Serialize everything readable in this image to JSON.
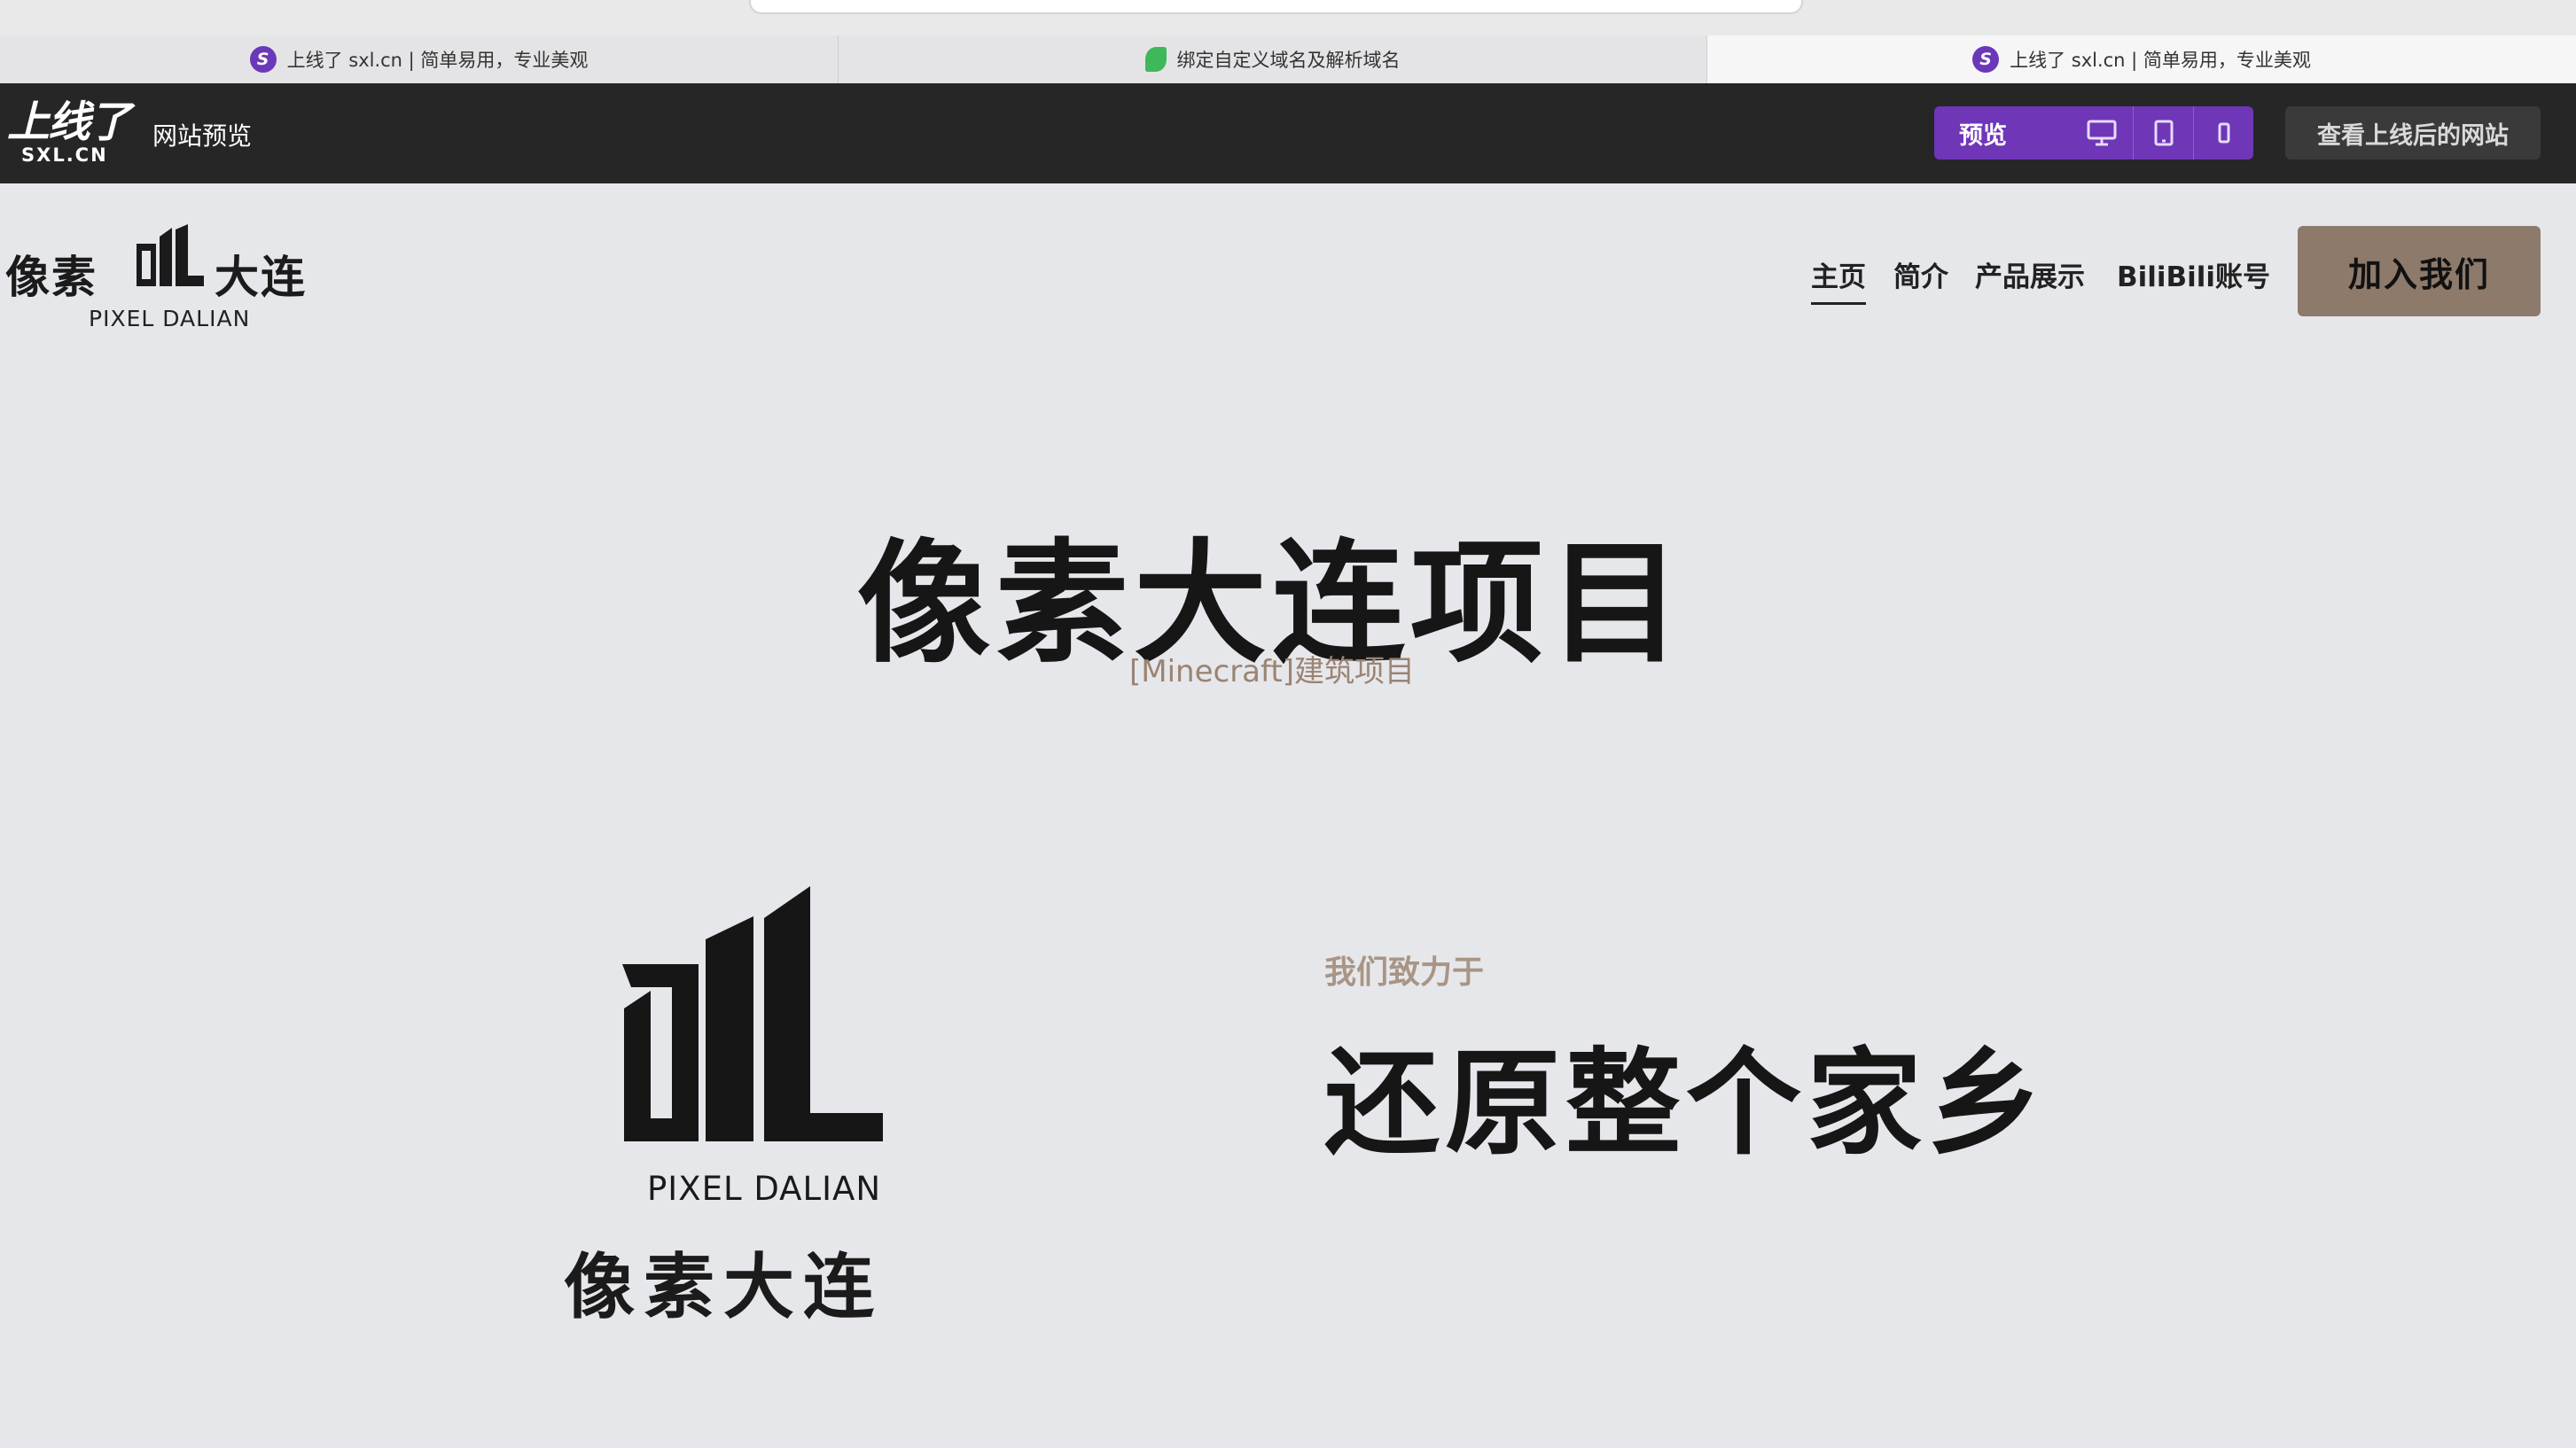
{
  "browser": {
    "tabs": [
      {
        "title": "上线了 sxl.cn | 简单易用，专业美观",
        "icon": "sxl-favicon",
        "active": false
      },
      {
        "title": "绑定自定义域名及解析域名",
        "icon": "leaf-favicon",
        "active": false
      },
      {
        "title": "上线了 sxl.cn | 简单易用，专业美观",
        "icon": "sxl-favicon",
        "active": true
      }
    ]
  },
  "toolbar": {
    "logo_main": "上线了",
    "logo_sub": "SXL.CN",
    "title": "网站预览",
    "preview_label": "预览",
    "devices": [
      "desktop-icon",
      "tablet-icon",
      "mobile-icon"
    ],
    "view_site_label": "查看上线后的网站",
    "accent": "#6f36b8"
  },
  "site": {
    "logo_cn_left": "像素",
    "logo_cn_right": "大连",
    "logo_en": "PIXEL DALIAN",
    "nav": [
      {
        "label": "主页",
        "active": true
      },
      {
        "label": "简介",
        "active": false
      },
      {
        "label": "产品展示",
        "active": false
      },
      {
        "label": "BiliBili账号",
        "active": false
      }
    ],
    "join_label": "加入我们",
    "join_color": "#8d7a6b"
  },
  "hero": {
    "title": "像素大连项目",
    "subtitle": "[Minecraft]建筑项目"
  },
  "feature": {
    "logo_en": "PIXEL DALIAN",
    "logo_cn": "像素大连",
    "eyebrow": "我们致力于",
    "title": "还原整个家乡"
  }
}
